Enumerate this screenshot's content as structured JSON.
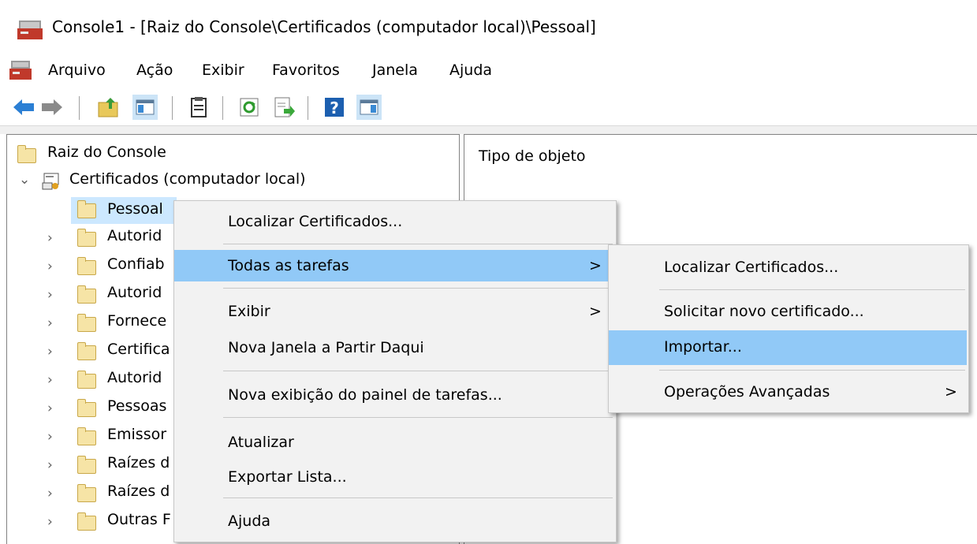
{
  "window": {
    "title": "Console1 - [Raiz do Console\\Certificados (computador local)\\Pessoal]"
  },
  "menubar": {
    "items": [
      "Arquivo",
      "Ação",
      "Exibir",
      "Favoritos",
      "Janela",
      "Ajuda"
    ]
  },
  "toolbar": {
    "buttons": [
      "back-arrow-icon",
      "forward-arrow-icon",
      "up-folder-icon",
      "show-hide-tree-icon",
      "properties-icon",
      "refresh-icon",
      "export-list-icon",
      "help-icon",
      "show-hide-action-pane-icon"
    ]
  },
  "tree": {
    "root": "Raiz do Console",
    "certs": "Certificados (computador local)",
    "children": [
      "Pessoal",
      "Autorid",
      "Confiab",
      "Autorid",
      "Fornece",
      "Certifica",
      "Autorid",
      "Pessoas",
      "Emissor",
      "Raízes d",
      "Raízes d",
      "Outras F"
    ]
  },
  "main": {
    "column_header": "Tipo de objeto"
  },
  "context_menu": {
    "items": [
      "Localizar Certificados...",
      "Todas as tarefas",
      "Exibir",
      "Nova Janela a Partir Daqui",
      "Nova exibição do painel de tarefas...",
      "Atualizar",
      "Exportar Lista...",
      "Ajuda"
    ],
    "submenu_arrow": ">"
  },
  "submenu": {
    "items": [
      "Localizar Certificados...",
      "Solicitar novo certificado...",
      "Importar...",
      "Operações Avançadas"
    ]
  },
  "colors": {
    "highlight": "#91c9f7",
    "selected_tree_item": "#cce8ff",
    "menu_bg": "#f2f2f2"
  }
}
